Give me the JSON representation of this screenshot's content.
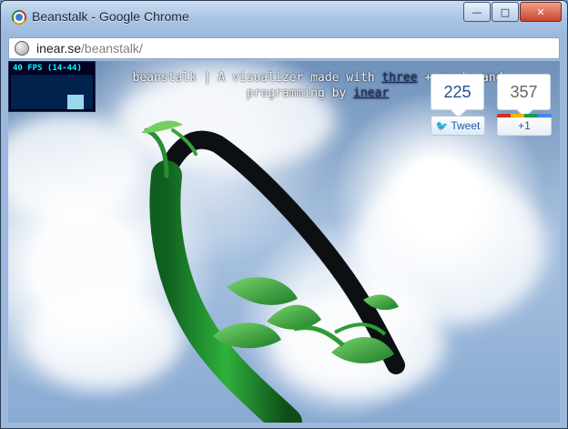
{
  "window": {
    "title": "Beanstalk - Google Chrome",
    "address_host": "inear.se",
    "address_path": "/beanstalk/"
  },
  "overlay": {
    "fps_label": "40 FPS (14-44)",
    "headline_start": "beanstalk | A visualizer made with ",
    "headline_link": "three",
    "headline_end": " + music and",
    "headline_line2_pre": "programming by ",
    "headline_line2_link": "inear"
  },
  "share": {
    "tweet_count": "225",
    "tweet_label": "Tweet",
    "plus_count": "357",
    "plus_label": "+1"
  },
  "colors": {
    "accent_blue": "#245aa5",
    "fps_cyan": "#00ffff",
    "plant_green": "#1b7f2f"
  },
  "icons": {
    "globe": "globe-icon",
    "twitter": "twitter-bird-icon",
    "google_plus": "google-plus-icon",
    "chrome": "chrome-logo-icon"
  }
}
